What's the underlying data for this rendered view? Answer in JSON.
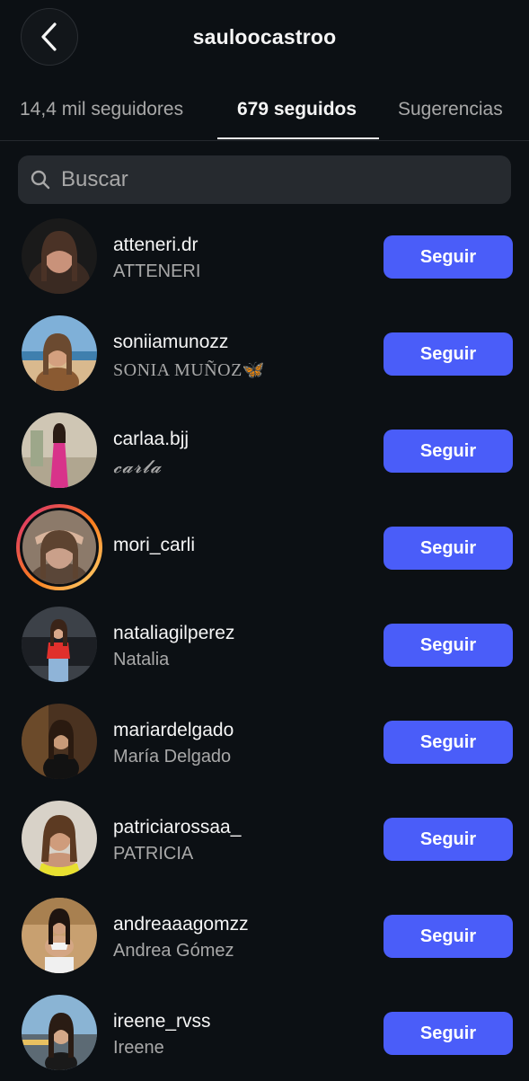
{
  "header": {
    "title": "sauloocastroo",
    "back_icon": "chevron-left-icon"
  },
  "tabs": [
    {
      "label": "14,4 mil seguidores",
      "active": false
    },
    {
      "label": "679 seguidos",
      "active": true
    },
    {
      "label": "Sugerencias",
      "active": false
    }
  ],
  "search": {
    "placeholder": "Buscar",
    "icon": "search-icon"
  },
  "colors": {
    "background": "#0c1014",
    "button": "#4a5df9",
    "search_bg": "#262a2f",
    "secondary_text": "#a8a8a8"
  },
  "follow_label": "Seguir",
  "users": [
    {
      "username": "atteneri.dr",
      "fullname": "ATTENERI",
      "story": false
    },
    {
      "username": "soniiamunozz",
      "fullname": "SONIA MUÑOZ🦋",
      "story": false
    },
    {
      "username": "carlaa.bjj",
      "fullname": "𝓬𝓪𝓻𝓵𝓪",
      "story": false
    },
    {
      "username": "mori_carli",
      "fullname": "",
      "story": true
    },
    {
      "username": "nataliagilperez",
      "fullname": "Natalia",
      "story": false
    },
    {
      "username": "mariardelgado",
      "fullname": "María Delgado",
      "story": false
    },
    {
      "username": "patriciarossaa_",
      "fullname": "PATRICIA",
      "story": false
    },
    {
      "username": "andreaaagomzz",
      "fullname": "Andrea Gómez",
      "story": false
    },
    {
      "username": "ireene_rvss",
      "fullname": "Ireene",
      "story": false
    }
  ]
}
